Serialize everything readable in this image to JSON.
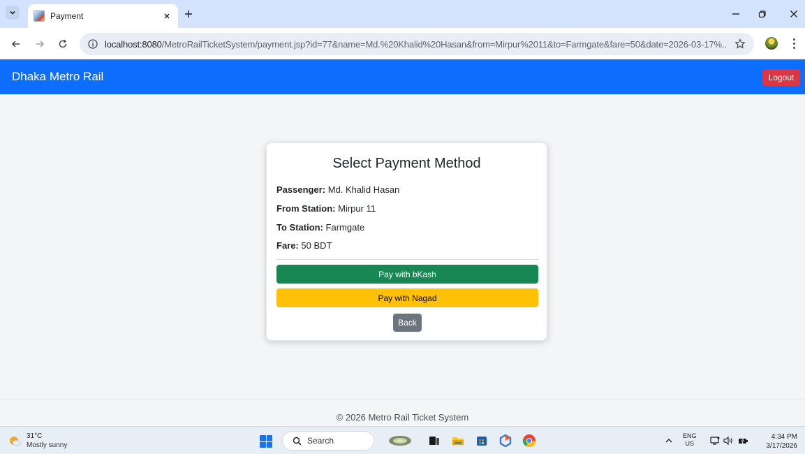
{
  "browser": {
    "tab_title": "Payment",
    "url_host": "localhost:8080",
    "url_path": "/MetroRailTicketSystem/payment.jsp?id=77&name=Md.%20Khalid%20Hasan&from=Mirpur%2011&to=Farmgate&fare=50&date=2026-03-17%..."
  },
  "navbar": {
    "brand": "Dhaka Metro Rail",
    "logout_label": "Logout"
  },
  "payment": {
    "title": "Select Payment Method",
    "fields": [
      {
        "label": "Passenger:",
        "value": "Md. Khalid Hasan"
      },
      {
        "label": "From Station:",
        "value": "Mirpur 11"
      },
      {
        "label": "To Station:",
        "value": "Farmgate"
      },
      {
        "label": "Fare:",
        "value": "50 BDT"
      }
    ],
    "bkash_label": "Pay with bKash",
    "nagad_label": "Pay with Nagad",
    "back_label": "Back"
  },
  "footer": {
    "text": "© 2026 Metro Rail Ticket System"
  },
  "taskbar": {
    "weather_temp": "31°C",
    "weather_desc": "Mostly sunny",
    "search_label": "Search",
    "lang_top": "ENG",
    "lang_bottom": "US",
    "time": "4:34 PM",
    "date": "3/17/2026"
  },
  "colors": {
    "navbar": "#0d6efd",
    "logout": "#dc3545",
    "bkash": "#198754",
    "nagad": "#ffc107",
    "back": "#6c757d"
  }
}
